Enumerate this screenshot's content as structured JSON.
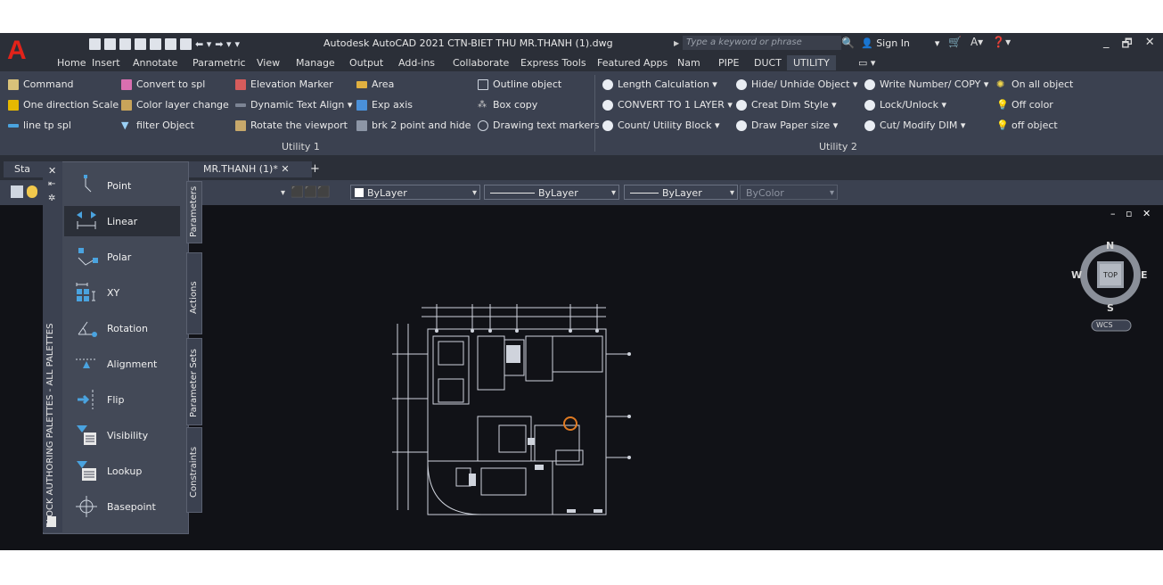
{
  "app": {
    "title": "Autodesk AutoCAD 2021   CTN-BIET THU MR.THANH (1).dwg",
    "search_placeholder": "Type a keyword or phrase",
    "sign_in": "Sign In",
    "brand_color": "#e2231a"
  },
  "tabs": [
    "Home",
    "Insert",
    "Annotate",
    "Parametric",
    "View",
    "Manage",
    "Output",
    "Add-ins",
    "Collaborate",
    "Express Tools",
    "Featured Apps",
    "Nam",
    "PIPE",
    "DUCT",
    "UTILITY"
  ],
  "ribbon": {
    "utility1": {
      "label": "Utility 1",
      "col1": [
        "Command",
        "One direction Scale",
        "line tp spl"
      ],
      "col2": [
        "Convert to spl",
        "Color  layer change",
        "filter Object"
      ],
      "col3": [
        "Elevation Marker",
        "Dynamic Text Align",
        "Rotate the viewport"
      ],
      "col4": [
        "Area",
        "Exp axis",
        "brk 2 point and hide"
      ],
      "col5": [
        "Outline object",
        "Box copy",
        "Drawing text markers"
      ]
    },
    "utility2": {
      "label": "Utility 2",
      "col1": [
        "Length Calculation",
        "CONVERT TO 1 LAYER",
        "Count/ Utility Block"
      ],
      "col2": [
        "Hide/ Unhide Object",
        "Creat Dim Style",
        "Draw Paper size"
      ],
      "col3": [
        "Write Number/ COPY",
        "Lock/Unlock",
        "Cut/ Modify DIM"
      ],
      "col4": [
        "On all object",
        "Off color",
        "off object"
      ]
    }
  },
  "doc_tabs": {
    "start": "Sta",
    "drawing": "MR.THANH (1)*",
    "close": "✕",
    "add": "+"
  },
  "toolbar": {
    "color": "ByLayer",
    "linetype": "ByLayer",
    "lineweight": "ByLayer",
    "plotstyle": "ByColor"
  },
  "palette": {
    "title": "BLOCK AUTHORING PALETTES - ALL PALETTES",
    "items": [
      "Point",
      "Linear",
      "Polar",
      "XY",
      "Rotation",
      "Alignment",
      "Flip",
      "Visibility",
      "Lookup",
      "Basepoint"
    ],
    "tabs": [
      "Parameters",
      "Actions",
      "Parameter Sets",
      "Constraints"
    ]
  },
  "viewcube": {
    "n": "N",
    "s": "S",
    "e": "E",
    "w": "W",
    "top": "TOP",
    "wcs": "WCS"
  }
}
